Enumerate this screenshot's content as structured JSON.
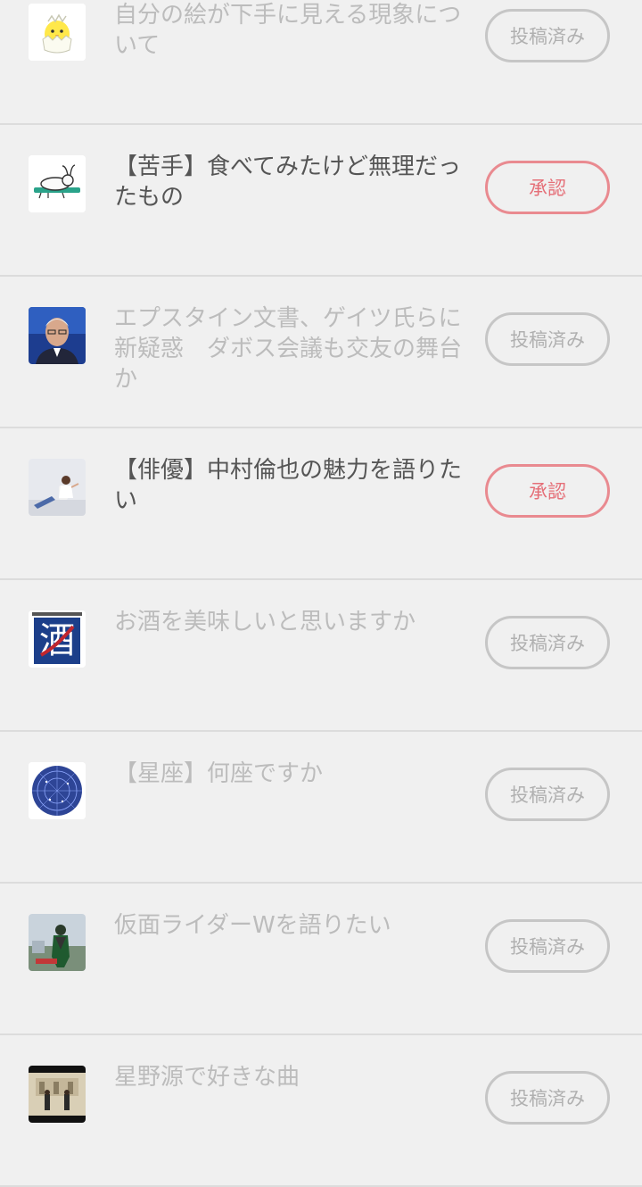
{
  "colors": {
    "background": "#f0f0f0",
    "divider": "#dcdcdc",
    "muted_text": "#bcbcbc",
    "active_text": "#555555",
    "approve_accent": "#e56f78",
    "posted_border": "#c6c6c6"
  },
  "topics": [
    {
      "title": "自分の絵が下手に見える現象について",
      "button": "投稿済み",
      "status": "posted",
      "thumbnail": "chick-egg-icon"
    },
    {
      "title": "【苦手】食べてみたけど無理だったもの",
      "button": "承認",
      "status": "approve",
      "thumbnail": "lying-rabbit-icon"
    },
    {
      "title": "エプスタイン文書、ゲイツ氏らに新疑惑　ダボス会議も交友の舞台か",
      "button": "投稿済み",
      "status": "posted",
      "thumbnail": "man-portrait-photo"
    },
    {
      "title": "【俳優】中村倫也の魅力を語りたい",
      "button": "承認",
      "status": "approve",
      "thumbnail": "actor-photo"
    },
    {
      "title": "お酒を美味しいと思いますか",
      "button": "投稿済み",
      "status": "posted",
      "thumbnail": "sake-kanji-image"
    },
    {
      "title": "【星座】何座ですか",
      "button": "投稿済み",
      "status": "posted",
      "thumbnail": "zodiac-circle-image"
    },
    {
      "title": "仮面ライダーWを語りたい",
      "button": "投稿済み",
      "status": "posted",
      "thumbnail": "rider-figure-photo"
    },
    {
      "title": "星野源で好きな曲",
      "button": "投稿済み",
      "status": "posted",
      "thumbnail": "music-video-photo"
    }
  ]
}
